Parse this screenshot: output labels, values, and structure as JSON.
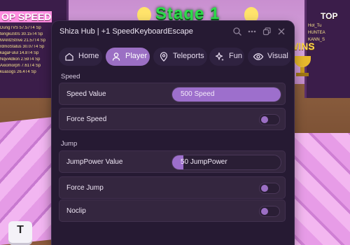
{
  "background": {
    "stage_title": "Stage 1",
    "top_speed_label": "OP SPEED",
    "wins_corner": "TOP",
    "wins_banner": "WINS",
    "key_label": "T",
    "leaderboard_left": [
      "DungTVS   57.57T4 Sp",
      "tengkuStrs 30.15T4 Sp",
      "MAMzStrive 21.57T4 Sp",
      "rdmoStatus 30.07T4 Sp",
      "kagaFulul 14.8T4 Sp",
      "Nqvi4dlion 2.59T4 Sp",
      "Axiomorph 7.61T4 Sp",
      "kuasogs 26.4T4 Sp"
    ],
    "leaderboard_right": [
      "Hot_Tu",
      "HUNTEA",
      "KANN_S"
    ]
  },
  "hub": {
    "title": "Shiza Hub | +1 SpeedKeyboardEscape",
    "tabs": [
      {
        "label": "Home",
        "icon": "home-icon"
      },
      {
        "label": "Player",
        "icon": "user-icon"
      },
      {
        "label": "Teleports",
        "icon": "map-pin-icon"
      },
      {
        "label": "Fun",
        "icon": "sparkle-icon"
      },
      {
        "label": "Visual",
        "icon": "eye-icon"
      }
    ],
    "active_tab": "Player",
    "sections": {
      "speed_label": "Speed",
      "jump_label": "Jump"
    },
    "speed_value": {
      "label": "Speed Value",
      "value_text": "500 Speed",
      "fill_fraction": 1.0
    },
    "force_speed": {
      "label": "Force Speed",
      "enabled": false
    },
    "jumppower_value": {
      "label": "JumpPower Value",
      "value_text": "50 JumpPower",
      "fill_fraction": 0.1
    },
    "force_jump": {
      "label": "Force Jump",
      "enabled": false
    },
    "noclip": {
      "label": "Noclip",
      "enabled": false
    }
  },
  "colors": {
    "accent": "#9b6fc4",
    "window_bg": "#261a33",
    "row_bg": "#34263f"
  }
}
